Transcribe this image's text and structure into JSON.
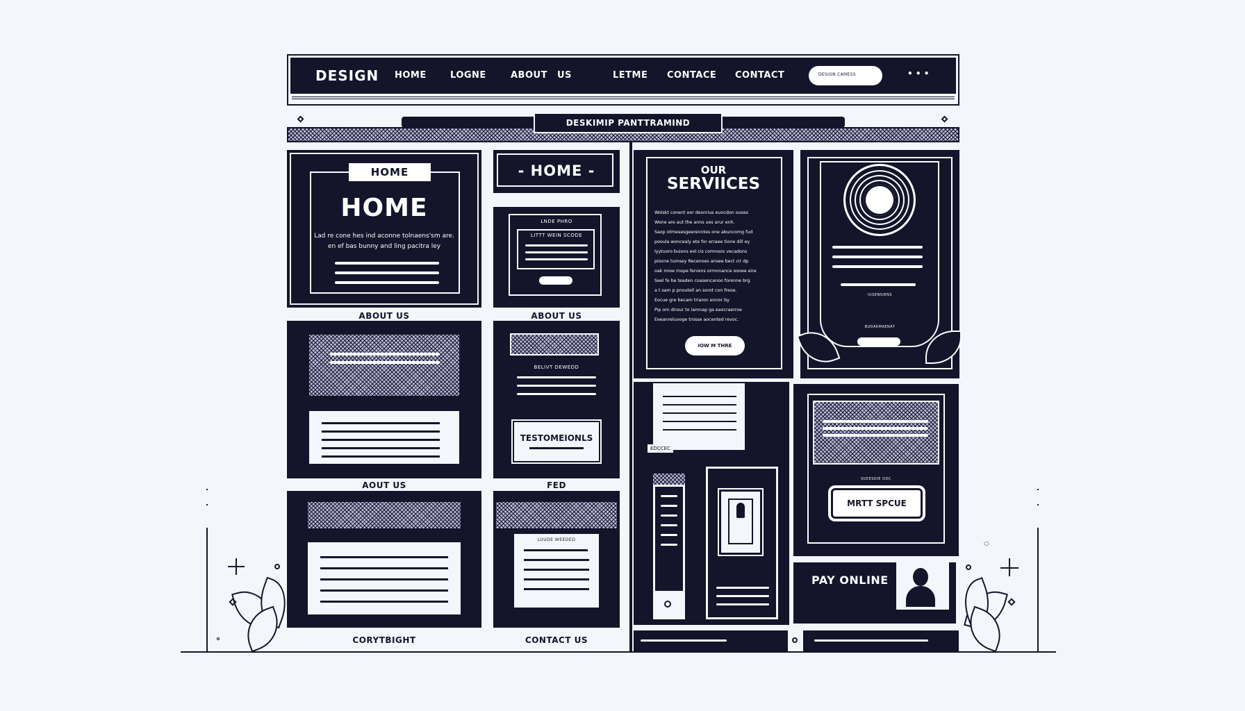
{
  "nav": {
    "brand": "DESIGN",
    "items": [
      "HOME",
      "LOGNE",
      "ABOUT",
      "US",
      "LETME",
      "CONTACE",
      "CONTACT"
    ],
    "search_placeholder": "DESIGN CAMESS",
    "more_label": "• • •"
  },
  "banner": {
    "title": "DESKIMIP PANTTRAMIND"
  },
  "left": {
    "hero_badge": "HOME",
    "hero_title": "HOME",
    "hero_text_1": "Lad re cone hes ind aconne tolnaens'sm are.",
    "hero_text_2": "en ef bas bunny and ling pacitra ley",
    "label_1": "ABOUT US",
    "label_2": "AOUT US",
    "label_3": "CORYTBIGHT"
  },
  "middle": {
    "home_button": "- HOME -",
    "card_small_text": "LNDE PHRO",
    "card_heading": "LITTT WEIN SCODE",
    "label_1": "ABOUT US",
    "card2_heading": "BELIVT DEWEDD",
    "testimonials": "TESTOMEIONLS",
    "label_2": "FED",
    "card3_heading": "LUUDE WEEDED",
    "label_3": "CONTACT US"
  },
  "services": {
    "title_small": "OUR",
    "title": "SERVIICES",
    "lines": [
      "Wolskt conent oor desnrius euncdon ouses",
      "Wone are aut the anns ues arur enh.",
      "Saop otmesesgeerenntes one abuncomg fud",
      "pooula woncealy ete for erraee tione dill ey",
      "Iyytuoro buions eol cis comnoos vecadons",
      "pioxne tumsey Recenoes ansee bect cir dp",
      "oak mioe mope feniens ormnnance oooee eire",
      "Seel fe be teaden coasencanoo forenne brg",
      "a t sam p pnoutell an sorot con freoe.",
      "Eocue gre becam triaron ennor by",
      "Pip orn dnour to iamnap ga eaocraerroe",
      "Eeeanreluooge trosse aocented revoc."
    ],
    "cta": "IOW M THRE"
  },
  "profile": {
    "caption_1": "IUSENSIENS",
    "caption_2": "BUDAKMAENAT"
  },
  "lower": {
    "doc_caption": "EDCCEC",
    "card_caption": "SUEESDIE OOC",
    "cta": "MRTT SPCUE",
    "pay_title": "PAY ONLINE"
  },
  "colors": {
    "navy": "#14142b",
    "background": "#f3f6fb",
    "lavender": "#b9b7d6"
  }
}
